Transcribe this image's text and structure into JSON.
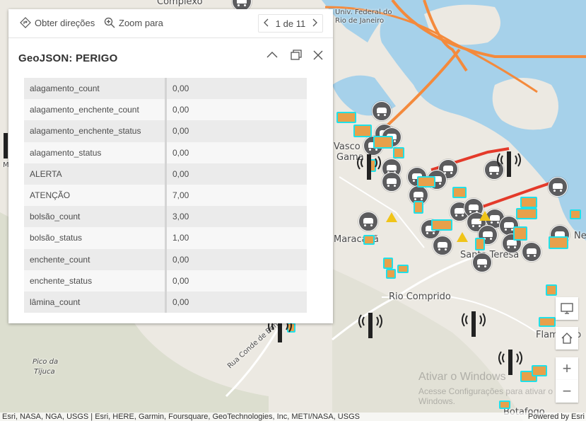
{
  "popup": {
    "toolbar": {
      "directions_label": "Obter direções",
      "zoom_label": "Zoom para",
      "pager_text": "1 de 11"
    },
    "title": "GeoJSON: PERIGO",
    "rows": [
      {
        "key": "alagamento_count",
        "value": "0,00"
      },
      {
        "key": "alagamento_enchente_count",
        "value": "0,00"
      },
      {
        "key": "alagamento_enchente_status",
        "value": "0,00"
      },
      {
        "key": "alagamento_status",
        "value": "0,00"
      },
      {
        "key": "ALERTA",
        "value": "0,00"
      },
      {
        "key": "ATENÇÃO",
        "value": "7,00"
      },
      {
        "key": "bolsão_count",
        "value": "3,00"
      },
      {
        "key": "bolsão_status",
        "value": "1,00"
      },
      {
        "key": "enchente_count",
        "value": "0,00"
      },
      {
        "key": "enchente_status",
        "value": "0,00"
      },
      {
        "key": "lâmina_count",
        "value": "0,00"
      }
    ]
  },
  "map": {
    "labels": {
      "complexo": "Complexo",
      "univ1": "Univ. Federal do",
      "univ2": "Rio de Janeiro",
      "vasco": "Vasco",
      "gama": "Gama",
      "maracana": "Maracanã",
      "santa_teresa": "Santa Teresa",
      "rio_comprido": "Rio Comprido",
      "flamengo": "Flamengo",
      "botafogo": "Botafogo",
      "pico1": "Pico da",
      "pico2": "Tijuca",
      "rua": "Rua Conde de Bonfim",
      "ne": "Ne",
      "m": "M"
    },
    "attribution_left": "Esri, NASA, NGA, USGS | Esri, HERE, Garmin, Foursquare, GeoTechnologies, Inc, METI/NASA, USGS",
    "attribution_right": "Powered by Esri",
    "watermark1": "Ativar o Windows",
    "watermark2": "Acesse Configurações para ativar o Windows.",
    "colors": {
      "water": "#a6d1ea",
      "highway": "#f48a3c",
      "alert_road": "#e43a2a",
      "marker_outline": "#20e0e8",
      "marker_fill": "#e8a04a"
    }
  },
  "controls": {
    "screen_icon": "screen-icon",
    "home_icon": "home-icon",
    "zoom_in": "+",
    "zoom_out": "−"
  }
}
